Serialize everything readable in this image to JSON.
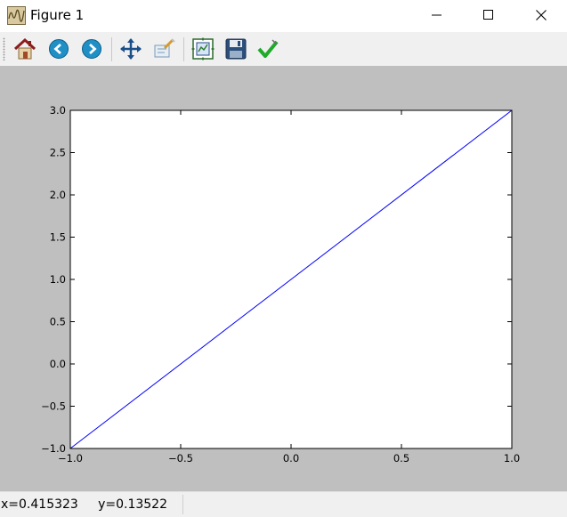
{
  "window": {
    "title": "Figure 1",
    "icon": "matplotlib-figure-icon",
    "controls": [
      "minimize-icon",
      "maximize-icon",
      "close-icon"
    ]
  },
  "toolbar": {
    "buttons": [
      {
        "name": "home",
        "icon": "home-icon"
      },
      {
        "name": "back",
        "icon": "back-arrow-icon"
      },
      {
        "name": "forward",
        "icon": "forward-arrow-icon"
      },
      {
        "name": "pan",
        "icon": "pan-move-icon"
      },
      {
        "name": "zoom",
        "icon": "zoom-rect-icon"
      },
      {
        "name": "subplots",
        "icon": "subplots-config-icon"
      },
      {
        "name": "save",
        "icon": "floppy-save-icon"
      },
      {
        "name": "edit",
        "icon": "checkmark-edit-icon"
      }
    ]
  },
  "chart_data": {
    "type": "line",
    "title": "",
    "xlabel": "",
    "ylabel": "",
    "xlim": [
      -1.0,
      1.0
    ],
    "ylim": [
      -1.0,
      3.0
    ],
    "xticks": [
      -1.0,
      -0.5,
      0.0,
      0.5,
      1.0
    ],
    "xtick_labels": [
      "−1.0",
      "−0.5",
      "0.0",
      "0.5",
      "1.0"
    ],
    "yticks": [
      -1.0,
      -0.5,
      0.0,
      0.5,
      1.0,
      1.5,
      2.0,
      2.5,
      3.0
    ],
    "ytick_labels": [
      "−1.0",
      "−0.5",
      "0.0",
      "0.5",
      "1.0",
      "1.5",
      "2.0",
      "2.5",
      "3.0"
    ],
    "grid": false,
    "series": [
      {
        "x": [
          -1.0,
          1.0
        ],
        "y": [
          -1.0,
          3.0
        ],
        "color": "#0000ff"
      }
    ]
  },
  "status": {
    "text": "x=0.415323     y=0.13522"
  },
  "colors": {
    "canvas_bg": "#bfbfbf",
    "axes_bg": "#ffffff",
    "line": "#0000ff"
  }
}
